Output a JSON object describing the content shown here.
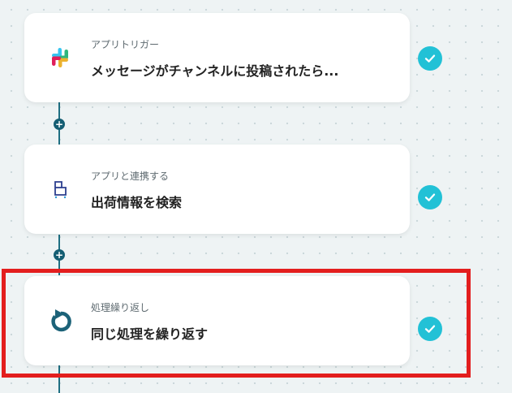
{
  "flow": {
    "steps": [
      {
        "label": "アプリトリガー",
        "title": "メッセージがチャンネルに投稿されたら...",
        "icon": "slack-icon",
        "status": "completed"
      },
      {
        "label": "アプリと連携する",
        "title": "出荷情報を検索",
        "icon": "warehouse-app-icon",
        "status": "completed"
      },
      {
        "label": "処理繰り返し",
        "title": "同じ処理を繰り返す",
        "icon": "loop-icon",
        "status": "completed"
      }
    ],
    "add_button_symbol": "+"
  },
  "colors": {
    "background": "#eef3f4",
    "connector": "#1f6f82",
    "add_button": "#155e73",
    "check_badge": "#22c1d6",
    "highlight": "#e31e1e",
    "loop_icon": "#1c6278"
  }
}
